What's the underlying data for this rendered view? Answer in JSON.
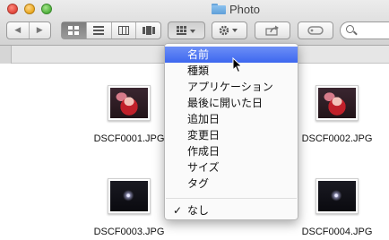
{
  "window": {
    "title": "Photo"
  },
  "toolbar": {
    "nav_buttons": [
      "◀",
      "▶"
    ],
    "view_buttons": [
      "icon-view",
      "list-view",
      "column-view",
      "coverflow-view"
    ],
    "arrange_icon": "arrange-grid-icon",
    "action_icon": "gear-icon",
    "share_icon": "share-icon",
    "tags_icon": "tag-icon",
    "search_placeholder": ""
  },
  "files": [
    {
      "name": "DSCF0001.JPG",
      "thumb": "red"
    },
    {
      "name": "DSCF0002.JPG",
      "thumb": "red"
    },
    {
      "name": "DSCF0003.JPG",
      "thumb": "dark"
    },
    {
      "name": "DSCF0004.JPG",
      "thumb": "dark"
    }
  ],
  "menu": {
    "items": [
      "名前",
      "種類",
      "アプリケーション",
      "最後に開いた日",
      "追加日",
      "変更日",
      "作成日",
      "サイズ",
      "タグ"
    ],
    "highlighted": "名前",
    "none_label": "なし",
    "check": "✓"
  },
  "colors": {
    "highlight": "#3d67ef",
    "folder": "#6aa6da"
  }
}
